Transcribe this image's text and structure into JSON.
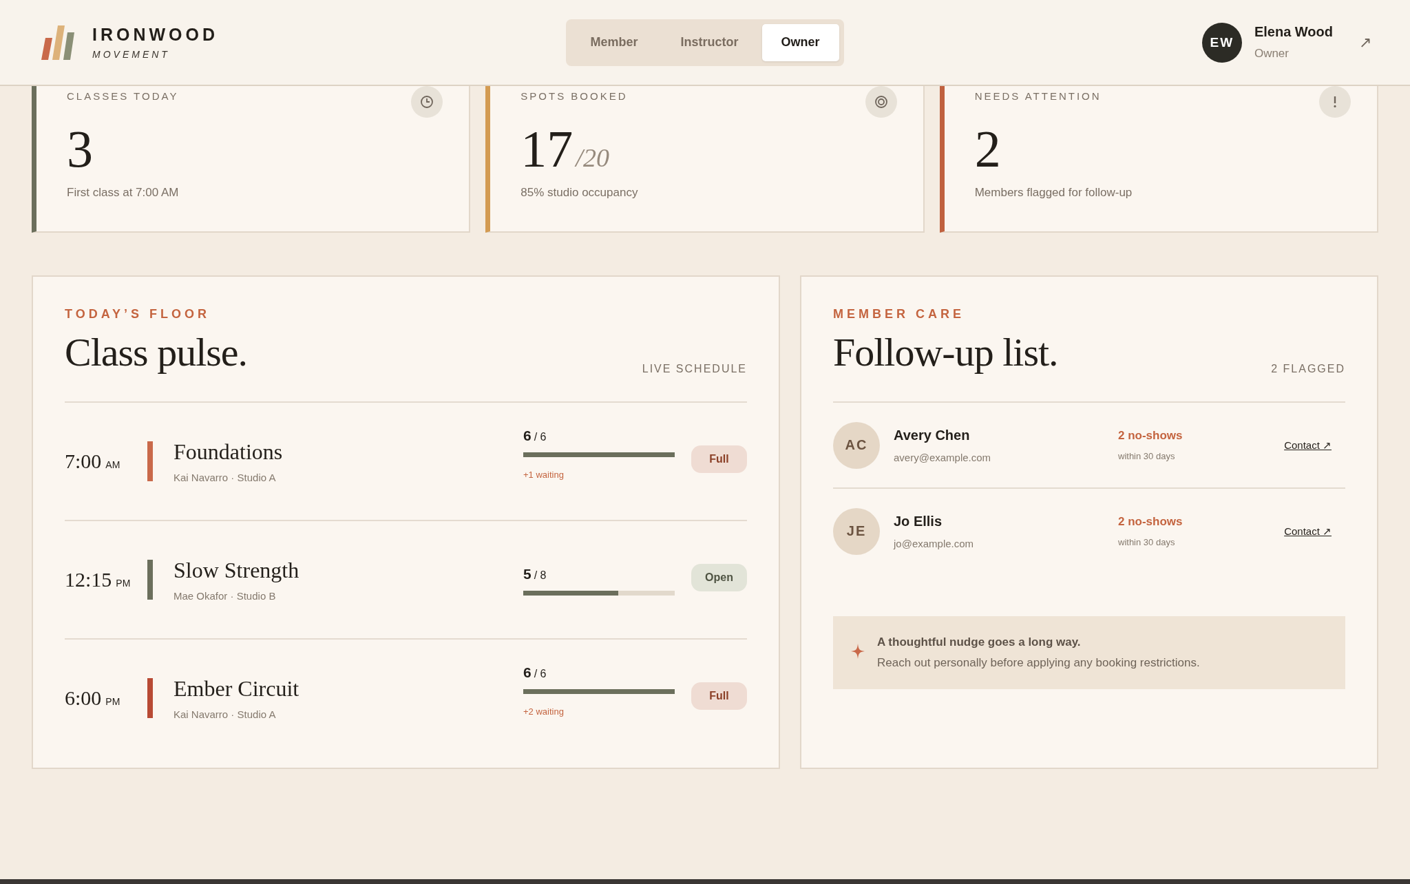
{
  "header": {
    "brand": {
      "name": "IRONWOOD",
      "tagline": "MOVEMENT"
    },
    "role_tabs": [
      {
        "label": "Member",
        "selected": false
      },
      {
        "label": "Instructor",
        "selected": false
      },
      {
        "label": "Owner",
        "selected": true
      }
    ],
    "user": {
      "initials": "EW",
      "name": "Elena Wood",
      "role": "Owner",
      "action": "↗"
    }
  },
  "stats": [
    {
      "label": "CLASSES TODAY",
      "value": "3",
      "caption": "First class at 7:00 AM",
      "color": "#6b6f5c",
      "kind": "clock"
    },
    {
      "label": "SPOTS BOOKED",
      "value": "17",
      "suffix": "/20",
      "caption": "85% studio occupancy",
      "color": "#d39b52",
      "kind": "target"
    },
    {
      "label": "NEEDS ATTENTION",
      "value": "2",
      "caption": "Members flagged for follow-up",
      "color": "#c0613f",
      "kind": "alert"
    }
  ],
  "class_pulse": {
    "eyebrow": "TODAY’S FLOOR",
    "title": "Class pulse.",
    "meta": "LIVE SCHEDULE",
    "rows": [
      {
        "time": "7:00",
        "meridiem": "AM",
        "name": "Foundations",
        "detail": "Kai Navarro · Studio A",
        "booked": "6",
        "capacity": "/ 6",
        "level": 1,
        "status": {
          "label": "Full",
          "kind": "full"
        },
        "waitlist": "+1 waiting",
        "color": "#c9694a"
      },
      {
        "time": "12:15",
        "meridiem": "PM",
        "name": "Slow Strength",
        "detail": "Mae Okafor · Studio B",
        "booked": "5",
        "capacity": "/ 8",
        "level": 0.625,
        "status": {
          "label": "Open",
          "kind": "open"
        },
        "color": "#6b6f5c"
      },
      {
        "time": "6:00",
        "meridiem": "PM",
        "name": "Ember Circuit",
        "detail": "Kai Navarro · Studio A",
        "booked": "6",
        "capacity": "/ 6",
        "level": 1,
        "status": {
          "label": "Full",
          "kind": "full"
        },
        "waitlist": "+2 waiting",
        "color": "#b84a34"
      }
    ]
  },
  "member_care": {
    "eyebrow": "MEMBER CARE",
    "title": "Follow-up list.",
    "meta": "2 FLAGGED",
    "members": [
      {
        "initials": "AC",
        "name": "Avery Chen",
        "email": "avery@example.com",
        "flag": "2 no-shows",
        "flag_note": "within 30 days",
        "action": "Contact ↗"
      },
      {
        "initials": "JE",
        "name": "Jo Ellis",
        "email": "jo@example.com",
        "flag": "2 no-shows",
        "flag_note": "within 30 days",
        "action": "Contact ↗"
      }
    ],
    "tip": {
      "title": "A thoughtful nudge goes a long way.",
      "body": "Reach out personally before applying any booking restrictions."
    }
  }
}
